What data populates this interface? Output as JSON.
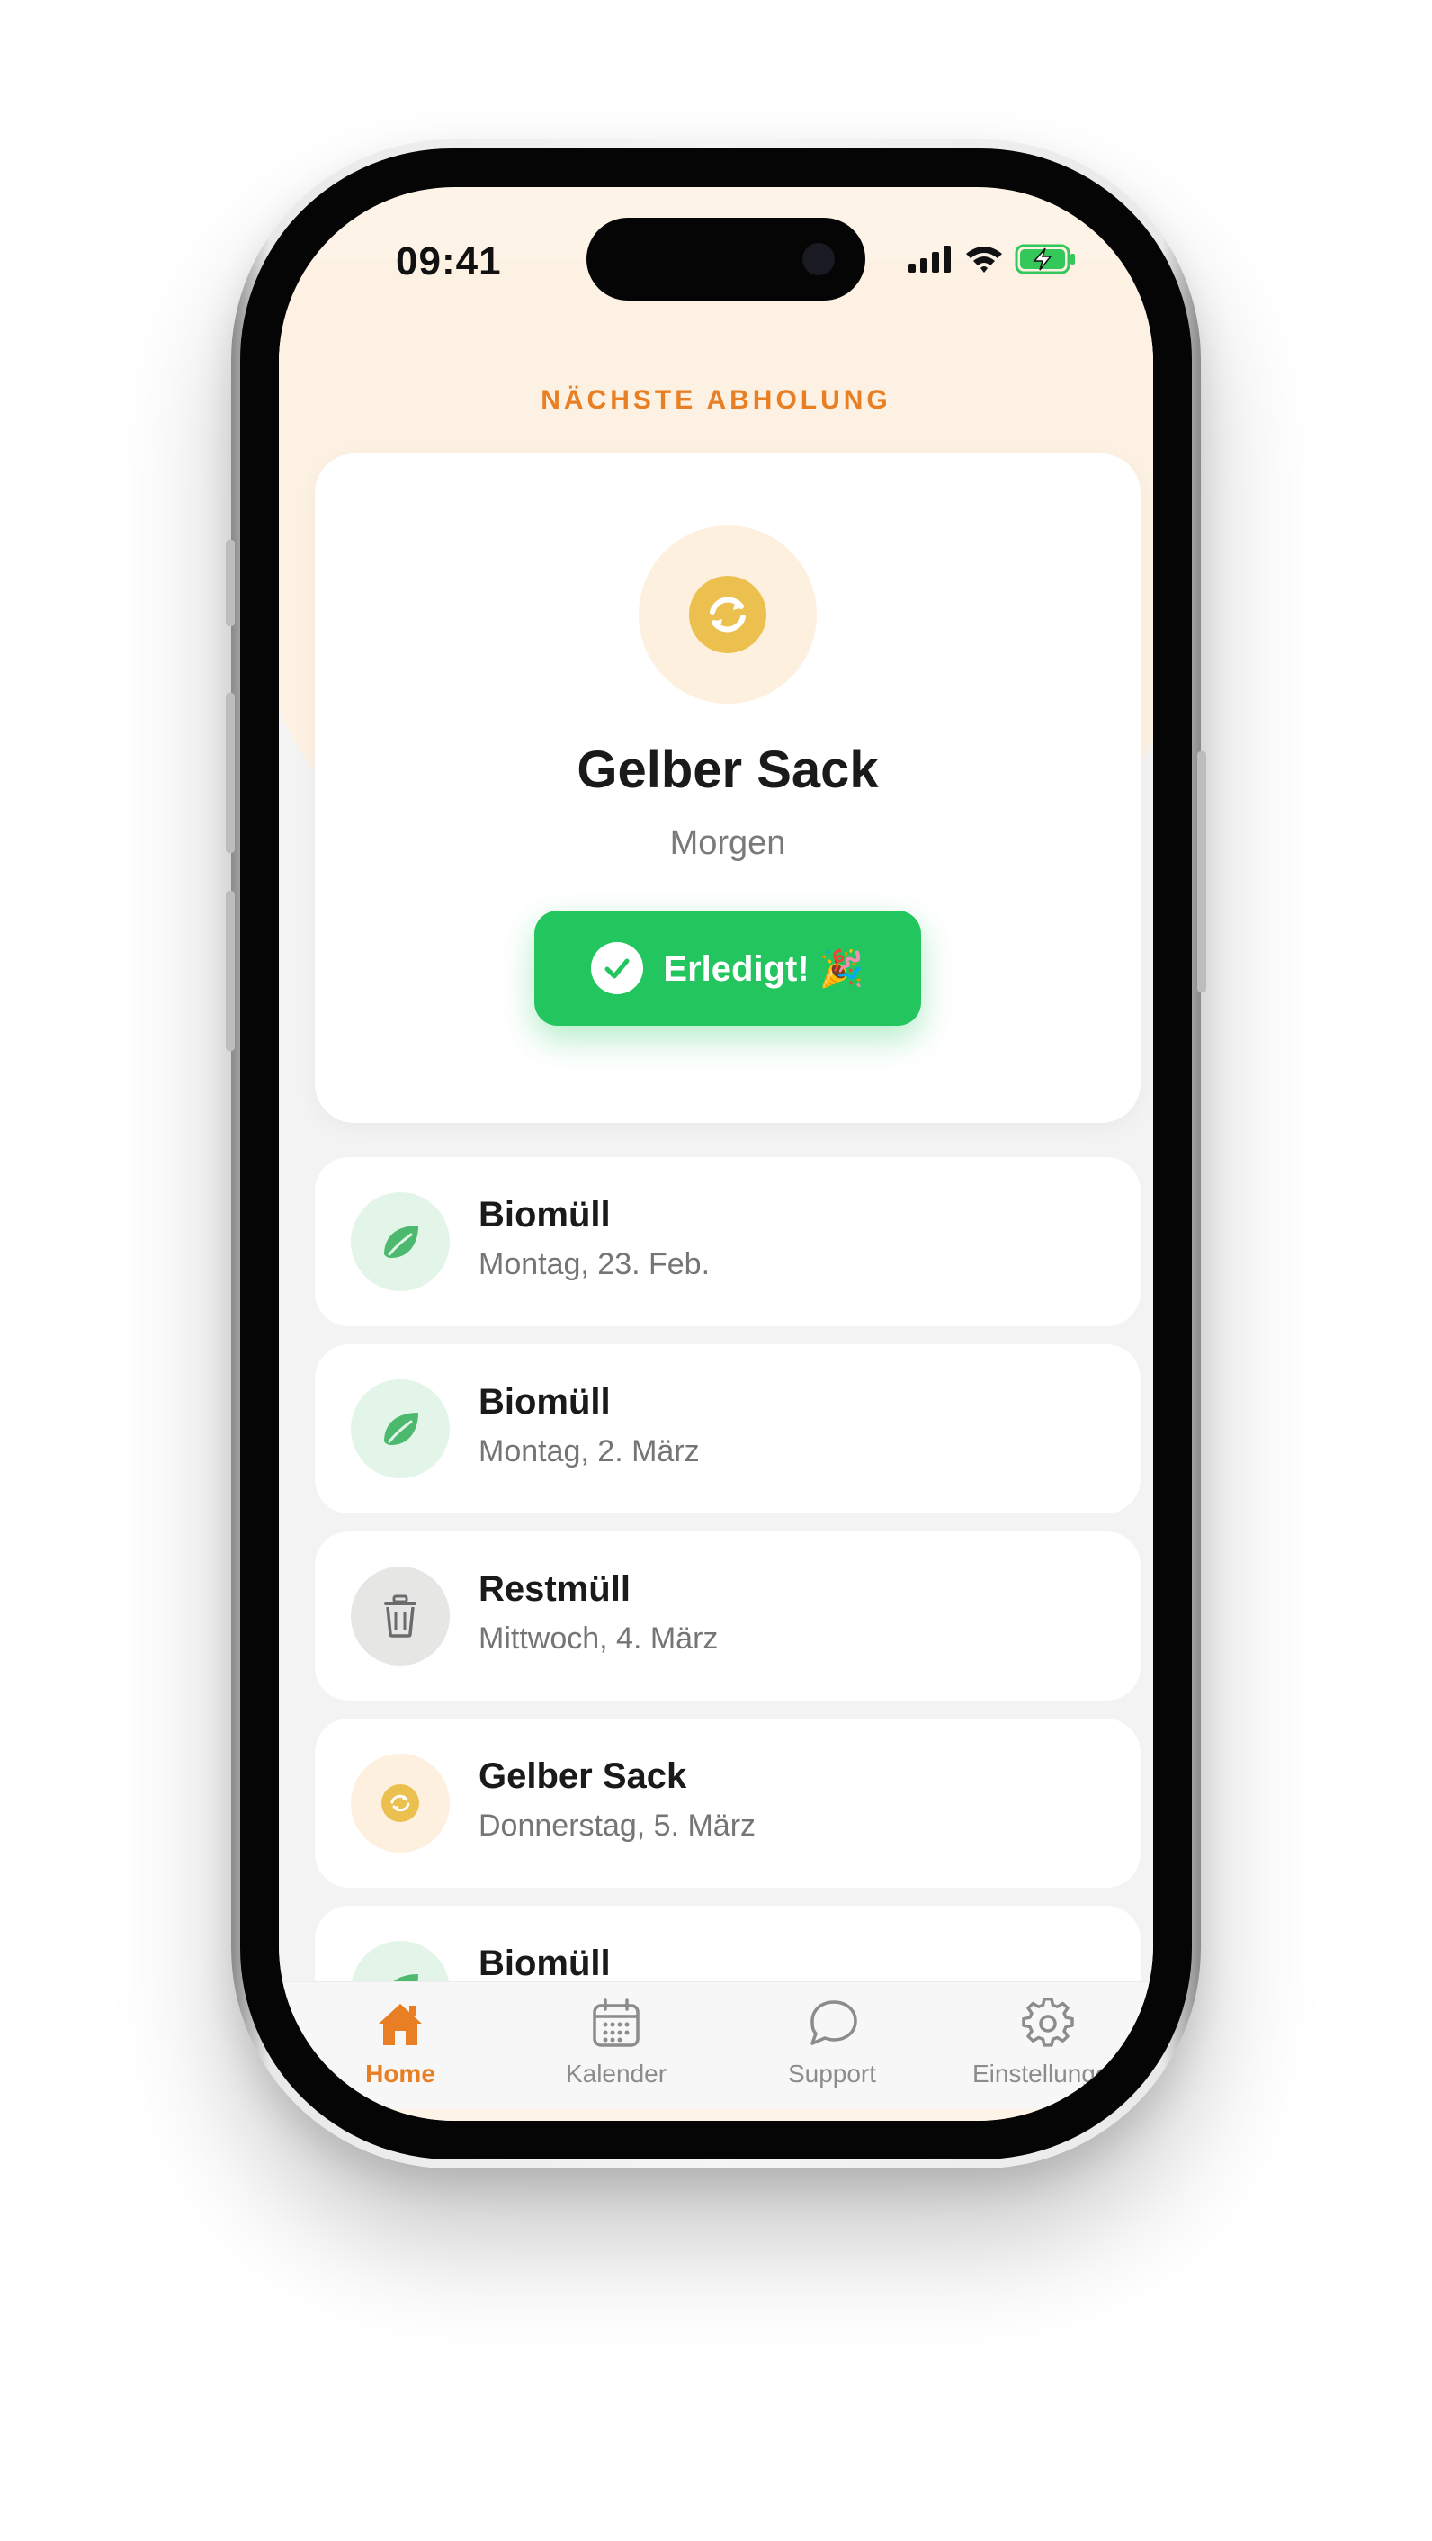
{
  "status_bar": {
    "time": "09:41"
  },
  "next_pickup": {
    "label": "NÄCHSTE ABHOLUNG",
    "title": "Gelber Sack",
    "when": "Morgen",
    "icon": "recycle-icon",
    "done_button": "Erledigt! 🎉"
  },
  "upcoming": [
    {
      "title": "Biomüll",
      "date": "Montag, 23. Feb.",
      "icon": "leaf-icon"
    },
    {
      "title": "Biomüll",
      "date": "Montag, 2. März",
      "icon": "leaf-icon"
    },
    {
      "title": "Restmüll",
      "date": "Mittwoch, 4. März",
      "icon": "trash-icon"
    },
    {
      "title": "Gelber Sack",
      "date": "Donnerstag, 5. März",
      "icon": "recycle-icon"
    },
    {
      "title": "Biomüll",
      "date": "",
      "icon": "leaf-icon"
    }
  ],
  "tabbar": {
    "tabs": [
      {
        "label": "Home",
        "icon": "home-icon",
        "active": true
      },
      {
        "label": "Kalender",
        "icon": "calendar-icon",
        "active": false
      },
      {
        "label": "Support",
        "icon": "chat-bubble-icon",
        "active": false
      },
      {
        "label": "Einstellungen",
        "icon": "gear-icon",
        "active": false
      }
    ]
  },
  "colors": {
    "accent_orange": "#e97f24",
    "success_green": "#22c55e",
    "yellow_sack": "#ecc04f",
    "bio_green": "#4cb96f"
  }
}
